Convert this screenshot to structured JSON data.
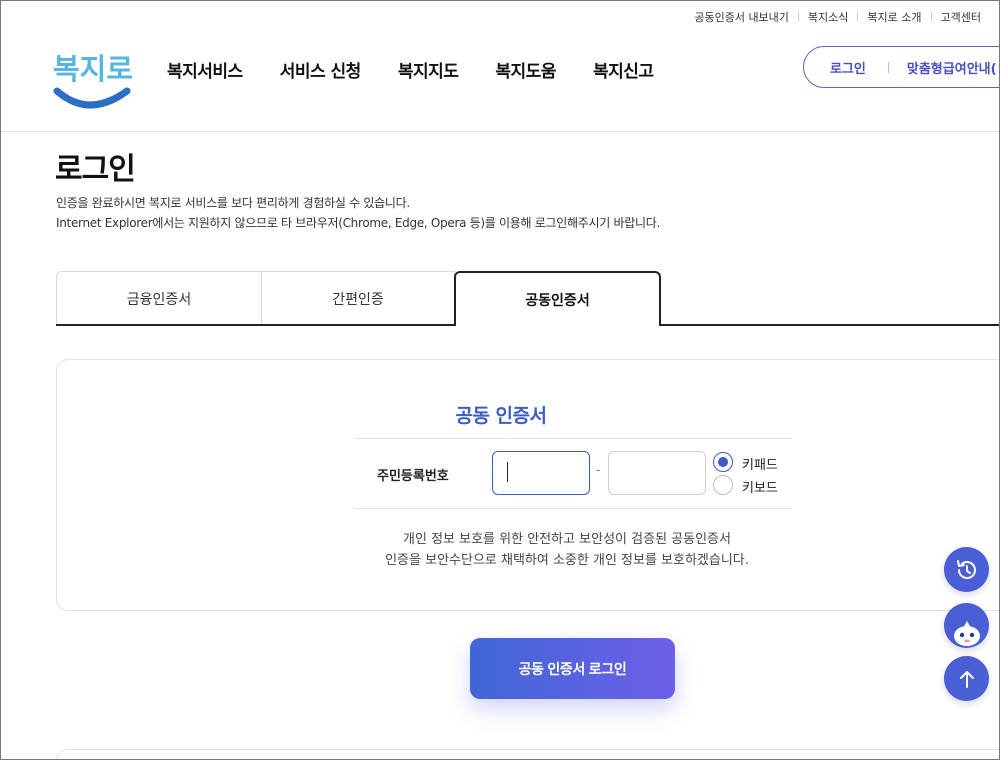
{
  "utility_links": [
    "공동인증서 내보내기",
    "복지소식",
    "복지로 소개",
    "고객센터"
  ],
  "logo": {
    "text": "복지로"
  },
  "gnb": [
    "복지서비스",
    "서비스 신청",
    "복지지도",
    "복지도움",
    "복지신고"
  ],
  "header_box": {
    "login": "로그인",
    "guide": "맞춤형급여안내("
  },
  "page": {
    "title": "로그인",
    "desc_line1": "인증을 완료하시면 복지로 서비스를 보다 편리하게 경험하실 수 있습니다.",
    "desc_line2": "Internet Explorer에서는 지원하지 않으므로 타 브라우저(Chrome, Edge, Opera 등)를 이용해 로그인해주시기 바랍니다."
  },
  "tabs": [
    {
      "label": "금융인증서",
      "active": false
    },
    {
      "label": "간편인증",
      "active": false
    },
    {
      "label": "공동인증서",
      "active": true
    }
  ],
  "cert": {
    "title": "공동 인증서",
    "ssn_label": "주민등록번호",
    "ssn_front": "",
    "ssn_back": "",
    "dash": "-",
    "radio_keypad": "키패드",
    "radio_keyboard": "키보드",
    "selected_input": "키패드",
    "notice_line1": "개인 정보 보호를 위한 안전하고 보안성이 검증된 공동인증서",
    "notice_line2": "인증을 보안수단으로 채택하여 소중한 개인 정보를 보호하겠습니다."
  },
  "login_button": "공동 인증서 로그인",
  "colors": {
    "primary": "#3d5bc4",
    "button_start": "#3f66d6",
    "button_end": "#6e5fe8",
    "fab": "#4a5ed6"
  },
  "floating_icons": [
    "history-icon",
    "chatbot-icon",
    "arrow-up-icon"
  ]
}
